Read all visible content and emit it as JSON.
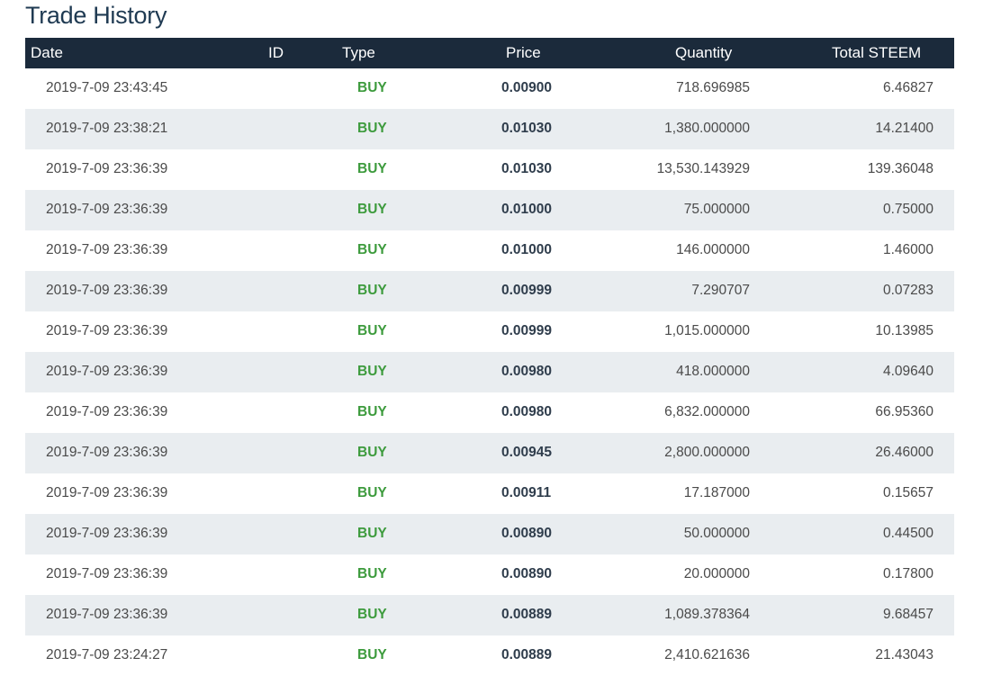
{
  "title": "Trade History",
  "columns": {
    "date": "Date",
    "id": "ID",
    "type": "Type",
    "price": "Price",
    "quantity": "Quantity",
    "total": "Total STEEM"
  },
  "colors": {
    "header_bg": "#1b2a3b",
    "stripe": "#e9edf0",
    "buy": "#3d9b3d"
  },
  "rows": [
    {
      "date": "2019-7-09 23:43:45",
      "type": "BUY",
      "price": "0.00900",
      "quantity": "718.696985",
      "total": "6.46827"
    },
    {
      "date": "2019-7-09 23:38:21",
      "type": "BUY",
      "price": "0.01030",
      "quantity": "1,380.000000",
      "total": "14.21400"
    },
    {
      "date": "2019-7-09 23:36:39",
      "type": "BUY",
      "price": "0.01030",
      "quantity": "13,530.143929",
      "total": "139.36048"
    },
    {
      "date": "2019-7-09 23:36:39",
      "type": "BUY",
      "price": "0.01000",
      "quantity": "75.000000",
      "total": "0.75000"
    },
    {
      "date": "2019-7-09 23:36:39",
      "type": "BUY",
      "price": "0.01000",
      "quantity": "146.000000",
      "total": "1.46000"
    },
    {
      "date": "2019-7-09 23:36:39",
      "type": "BUY",
      "price": "0.00999",
      "quantity": "7.290707",
      "total": "0.07283"
    },
    {
      "date": "2019-7-09 23:36:39",
      "type": "BUY",
      "price": "0.00999",
      "quantity": "1,015.000000",
      "total": "10.13985"
    },
    {
      "date": "2019-7-09 23:36:39",
      "type": "BUY",
      "price": "0.00980",
      "quantity": "418.000000",
      "total": "4.09640"
    },
    {
      "date": "2019-7-09 23:36:39",
      "type": "BUY",
      "price": "0.00980",
      "quantity": "6,832.000000",
      "total": "66.95360"
    },
    {
      "date": "2019-7-09 23:36:39",
      "type": "BUY",
      "price": "0.00945",
      "quantity": "2,800.000000",
      "total": "26.46000"
    },
    {
      "date": "2019-7-09 23:36:39",
      "type": "BUY",
      "price": "0.00911",
      "quantity": "17.187000",
      "total": "0.15657"
    },
    {
      "date": "2019-7-09 23:36:39",
      "type": "BUY",
      "price": "0.00890",
      "quantity": "50.000000",
      "total": "0.44500"
    },
    {
      "date": "2019-7-09 23:36:39",
      "type": "BUY",
      "price": "0.00890",
      "quantity": "20.000000",
      "total": "0.17800"
    },
    {
      "date": "2019-7-09 23:36:39",
      "type": "BUY",
      "price": "0.00889",
      "quantity": "1,089.378364",
      "total": "9.68457"
    },
    {
      "date": "2019-7-09 23:24:27",
      "type": "BUY",
      "price": "0.00889",
      "quantity": "2,410.621636",
      "total": "21.43043"
    }
  ]
}
